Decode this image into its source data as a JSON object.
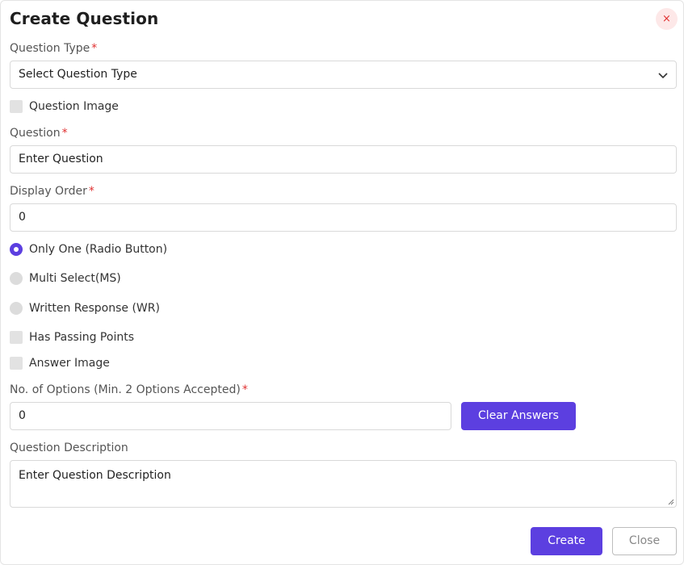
{
  "dialog": {
    "title": "Create Question",
    "close_icon": "close-icon",
    "close_glyph": "×"
  },
  "question_type": {
    "label": "Question Type",
    "required_mark": "*",
    "value": "Select Question Type",
    "icon": "chevron-down-icon"
  },
  "question_image": {
    "label": "Question Image",
    "checked": false
  },
  "question": {
    "label": "Question",
    "required_mark": "*",
    "placeholder": "Enter Question"
  },
  "display_order": {
    "label": "Display Order",
    "required_mark": "*",
    "value": "0"
  },
  "answer_types": [
    {
      "label": "Only One (Radio Button)",
      "selected": true
    },
    {
      "label": "Multi Select(MS)",
      "selected": false
    },
    {
      "label": "Written Response (WR)",
      "selected": false
    }
  ],
  "has_passing_points": {
    "label": "Has Passing Points",
    "checked": false
  },
  "answer_image": {
    "label": "Answer Image",
    "checked": false
  },
  "options": {
    "label": "No. of Options (Min. 2 Options Accepted)",
    "required_mark": "*",
    "value": "0",
    "clear_button": "Clear Answers"
  },
  "description": {
    "label": "Question Description",
    "placeholder": "Enter Question Description"
  },
  "footer": {
    "create_button": "Create",
    "close_button": "Close"
  },
  "colors": {
    "accent": "#5c3fe0",
    "required": "#e03131",
    "close_bg": "#fde8e8"
  }
}
